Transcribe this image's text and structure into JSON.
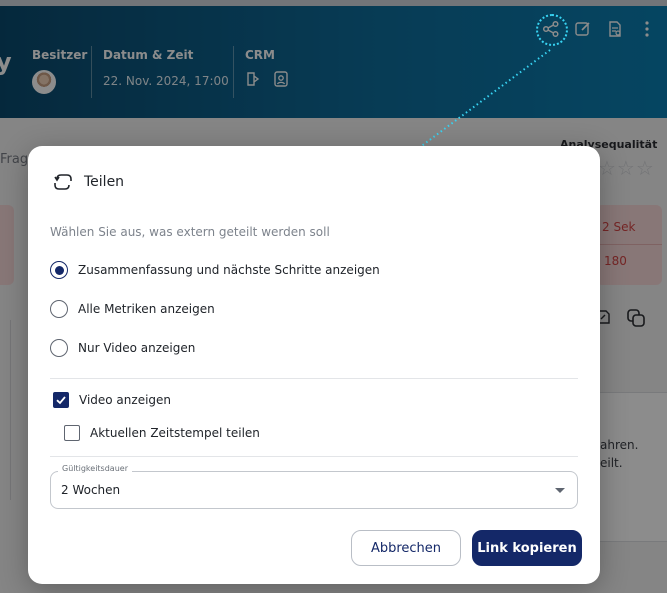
{
  "header": {
    "partial_title": "y",
    "owner_label": "Besitzer",
    "datetime_label": "Datum & Zeit",
    "datetime_value": "22. Nov. 2024, 17:00",
    "crm_label": "CRM",
    "actions": [
      "share-icon",
      "edit-icon",
      "document-icon",
      "more-icon"
    ]
  },
  "background": {
    "fragments_label": "Frag",
    "quality_label": "Analysequalität",
    "stars": "☆☆☆",
    "seconds_text": "2 Sek",
    "number_text": "180",
    "text_line1": "ahren.",
    "text_line2": "eilt."
  },
  "dialog": {
    "title": "Teilen",
    "subtitle": "Wählen Sie aus, was extern geteilt werden soll",
    "options": [
      {
        "label": "Zusammenfassung und nächste Schritte anzeigen",
        "selected": true
      },
      {
        "label": "Alle Metriken anzeigen",
        "selected": false
      },
      {
        "label": "Nur Video anzeigen",
        "selected": false
      }
    ],
    "show_video": {
      "label": "Video anzeigen",
      "checked": true
    },
    "share_timestamp": {
      "label": "Aktuellen Zeitstempel teilen",
      "checked": false
    },
    "validity": {
      "label": "Gültigkeitsdauer",
      "value": "2 Wochen"
    },
    "cancel_label": "Abbrechen",
    "copy_label": "Link kopieren"
  },
  "colors": {
    "primary": "#142868",
    "header_start": "#0a4a6e",
    "header_end": "#0a7fb2",
    "highlight": "#37d3f2"
  }
}
